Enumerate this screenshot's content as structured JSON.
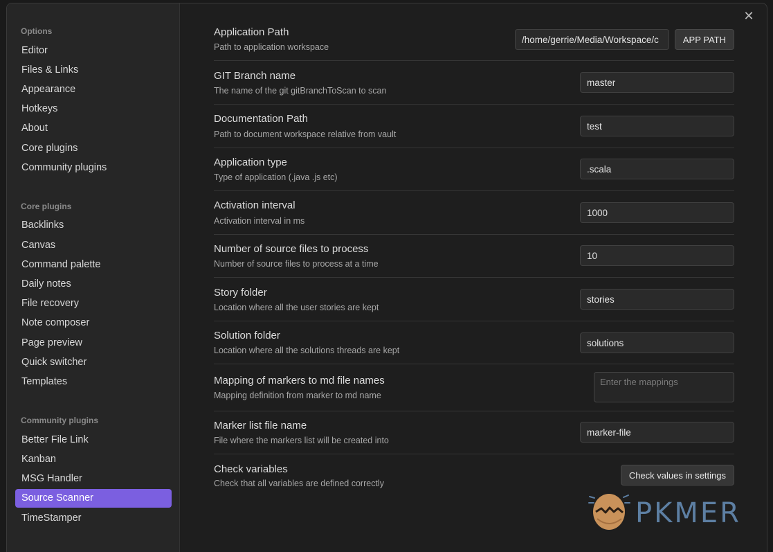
{
  "sidebar": {
    "options_title": "Options",
    "options_items": [
      "Editor",
      "Files & Links",
      "Appearance",
      "Hotkeys",
      "About",
      "Core plugins",
      "Community plugins"
    ],
    "core_title": "Core plugins",
    "core_items": [
      "Backlinks",
      "Canvas",
      "Command palette",
      "Daily notes",
      "File recovery",
      "Note composer",
      "Page preview",
      "Quick switcher",
      "Templates"
    ],
    "community_title": "Community plugins",
    "community_items": [
      "Better File Link",
      "Kanban",
      "MSG Handler",
      "Source Scanner",
      "TimeStamper"
    ],
    "active_item": "Source Scanner"
  },
  "close_icon": "close-icon",
  "settings": {
    "app_path": {
      "name": "Application Path",
      "desc": "Path to application workspace",
      "value": "/home/gerrie/Media/Workspace/c",
      "button": "APP PATH"
    },
    "git_branch": {
      "name": "GIT Branch name",
      "desc": "The name of the git gitBranchToScan to scan",
      "value": "master"
    },
    "doc_path": {
      "name": "Documentation Path",
      "desc": "Path to document workspace relative from vault",
      "value": "test"
    },
    "app_type": {
      "name": "Application type",
      "desc": "Type of application (.java .js etc)",
      "value": ".scala"
    },
    "activation": {
      "name": "Activation interval",
      "desc": "Activation interval in ms",
      "value": "1000"
    },
    "num_files": {
      "name": "Number of source files to process",
      "desc": "Number of source files to process at a time",
      "value": "10"
    },
    "story_folder": {
      "name": "Story folder",
      "desc": "Location where all the user stories are kept",
      "value": "stories"
    },
    "solution_folder": {
      "name": "Solution folder",
      "desc": "Location where all the solutions threads are kept",
      "value": "solutions"
    },
    "mapping": {
      "name": "Mapping of markers to md file names",
      "desc": "Mapping definition from marker to md name",
      "placeholder": "Enter the mappings"
    },
    "marker_file": {
      "name": "Marker list file name",
      "desc": "File where the markers list will be created into",
      "value": "marker-file"
    },
    "check_vars": {
      "name": "Check variables",
      "desc": "Check that all variables are defined correctly",
      "button": "Check values in settings"
    }
  },
  "watermark": {
    "text": "PKMER"
  },
  "colors": {
    "accent": "#7b5fe0",
    "background": "#1e1e1e",
    "sidebar": "#262626"
  }
}
